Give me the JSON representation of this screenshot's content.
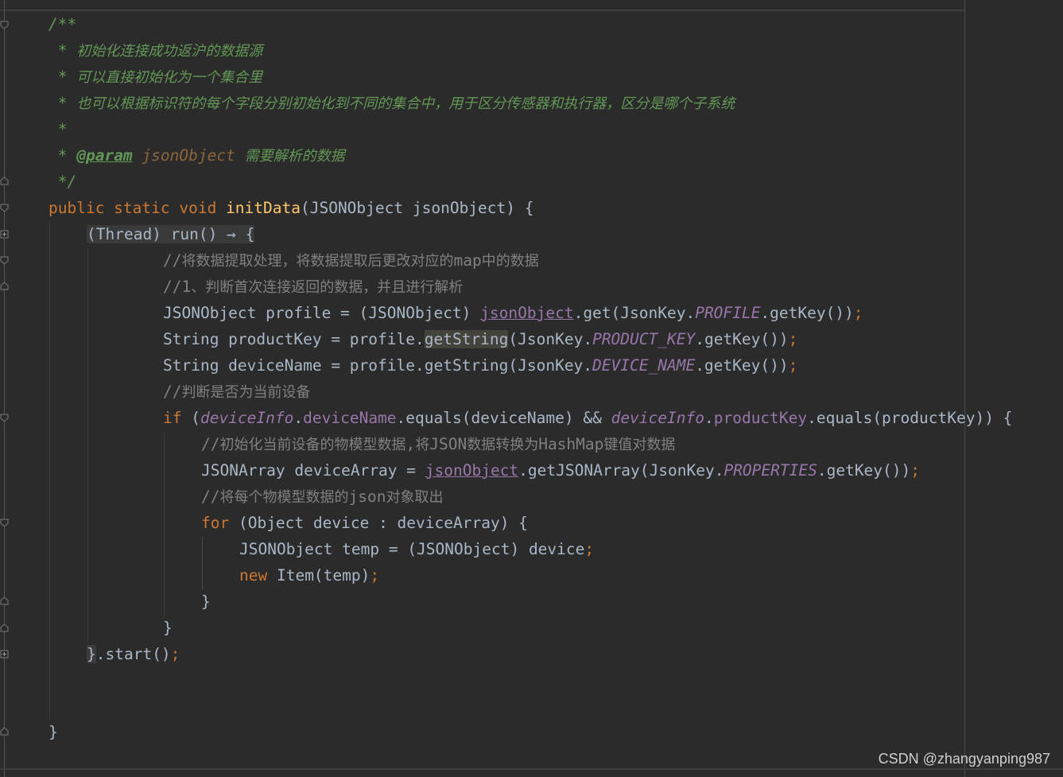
{
  "editor": {
    "language": "java",
    "theme_colors": {
      "background": "#2b2b2b",
      "default_text": "#a9b7c6",
      "keyword": "#cc7832",
      "method_declaration": "#ffc66d",
      "doc_comment": "#629755",
      "line_comment": "#808080",
      "field": "#9876aa",
      "param_name": "#8a653b"
    },
    "tokens": {
      "l1": {
        "a": "/**"
      },
      "l2": {
        "a": " * ",
        "b": "初始化连接成功返沪的数据源"
      },
      "l3": {
        "a": " * ",
        "b": "可以直接初始化为一个集合里"
      },
      "l4": {
        "a": " * ",
        "b": "也可以根据标识符的每个字段分别初始化到不同的集合中，用于区分传感器和执行器，区分是哪个子系统"
      },
      "l5": {
        "a": " *"
      },
      "l6": {
        "a": " * ",
        "tag": "@param",
        "pname": " jsonObject ",
        "b": "需要解析的数据"
      },
      "l7": {
        "a": " */"
      },
      "l8": {
        "kw": "public static void ",
        "fn": "initData",
        "rest": "(JSONObject jsonObject) {"
      },
      "l9": {
        "lambda": "(Thread) run() → {"
      },
      "l10": {
        "a": "//",
        "b": "将数据提取处理，将数据提取后更改对应的",
        "c": "map",
        "d": "中的数据"
      },
      "l11": {
        "a": "//1",
        "b": "、判断首次连接返回的数据，并且进行解析"
      },
      "l12": {
        "a": "JSONObject profile = (JSONObject) ",
        "link": "jsonObject",
        "b": ".get(JsonKey.",
        "f": "PROFILE",
        "c": ".getKey())",
        "semi": ";"
      },
      "l13": {
        "a": "String productKey = profile.",
        "hl": "getString",
        "b": "(JsonKey.",
        "f": "PRODUCT_KEY",
        "c": ".getKey())",
        "semi": ";"
      },
      "l14": {
        "a": "String deviceName = profile.getString(JsonKey.",
        "f": "DEVICE_NAME",
        "c": ".getKey())",
        "semi": ";"
      },
      "l15": {
        "a": "//",
        "b": "判断是否为当前设备"
      },
      "l16": {
        "kw": "if ",
        "a": "(",
        "f1": "deviceInfo",
        "b": ".",
        "g1": "deviceName",
        "c": ".equals(deviceName) && ",
        "f2": "deviceInfo",
        "d": ".",
        "g2": "productKey",
        "e": ".equals(productKey)) {"
      },
      "l17": {
        "a": "//",
        "b": "初始化当前设备的物模型数据",
        "c": ",",
        "d": "将",
        "e": "JSON",
        "f": "数据转换为",
        "g": "HashMap",
        "h": "键值对数据"
      },
      "l18": {
        "a": "JSONArray deviceArray = ",
        "link": "jsonObject",
        "b": ".getJSONArray(JsonKey.",
        "f": "PROPERTIES",
        "c": ".getKey())",
        "semi": ";"
      },
      "l19": {
        "a": "//",
        "b": "将每个物模型数据的",
        "c": "json",
        "d": "对象取出"
      },
      "l20": {
        "kw": "for ",
        "a": "(Object device : deviceArray) {"
      },
      "l21": {
        "a": "JSONObject temp = (JSONObject) device",
        "semi": ";"
      },
      "l22": {
        "kw": "new ",
        "a": "Item(temp)",
        "semi": ";"
      },
      "l23": {
        "a": "}"
      },
      "l24": {
        "a": "}"
      },
      "l25": {
        "brace": "}",
        "a": ".start()",
        "semi": ";"
      },
      "l28": {
        "a": "}"
      }
    }
  },
  "watermark": "CSDN @zhangyanping987"
}
